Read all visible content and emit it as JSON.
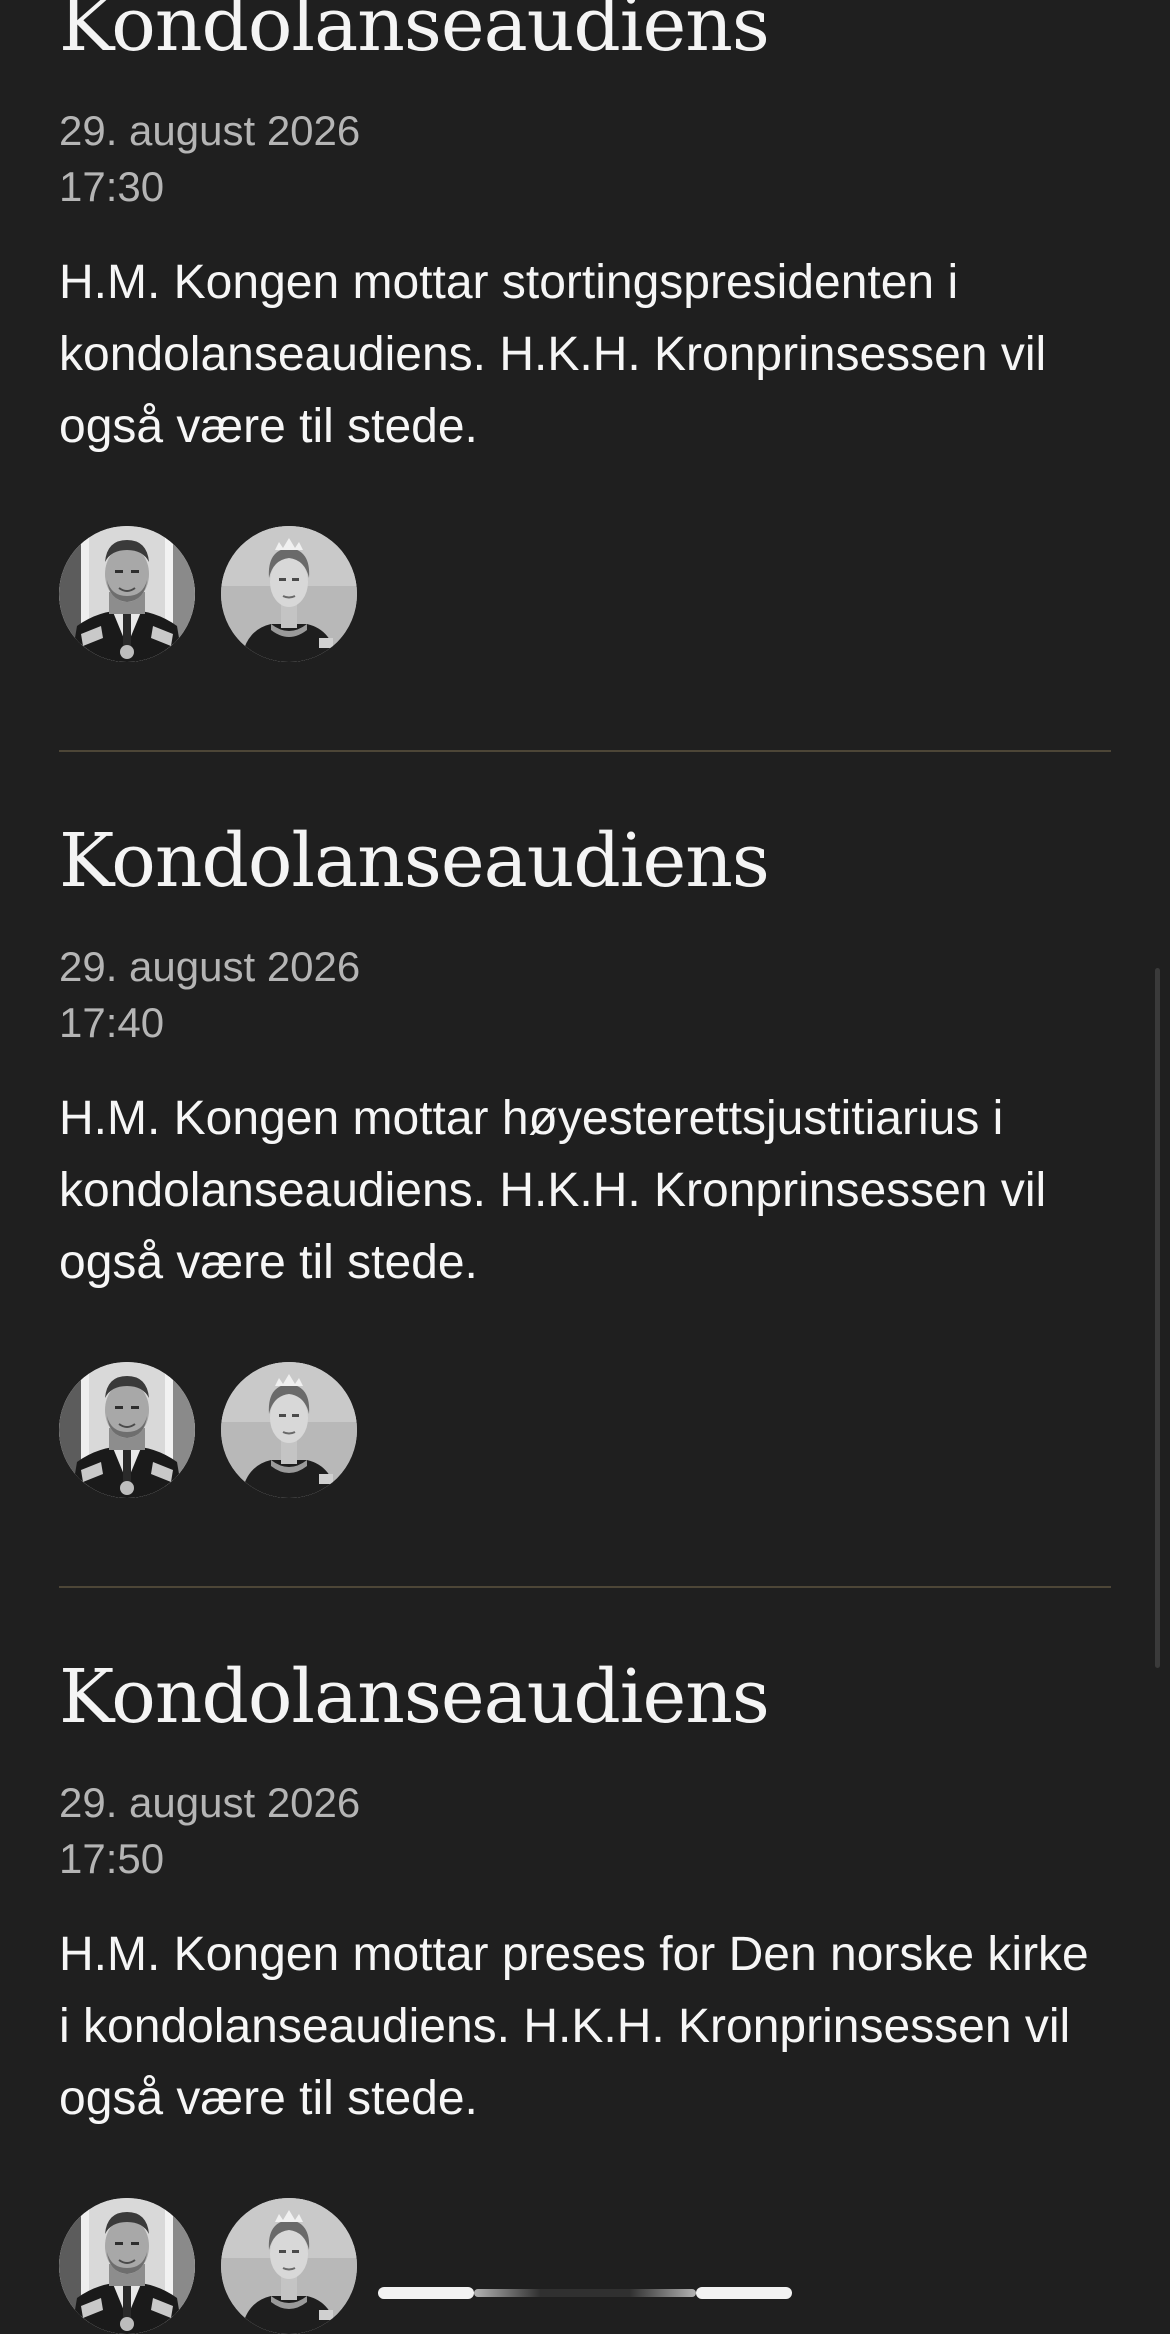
{
  "events": [
    {
      "title": "Kondolanseaudiens",
      "date": "29. august 2026",
      "time": "17:30",
      "description": "H.M. Kongen mottar stortingspresidenten i kondolanseaudiens. H.K.H. Kronprinsessen vil også være til stede.",
      "participants": [
        "avatar-king-icon",
        "avatar-crown-princess-icon"
      ]
    },
    {
      "title": "Kondolanseaudiens",
      "date": "29. august 2026",
      "time": "17:40",
      "description": "H.M. Kongen mottar høyesterettsjustitiarius i kondolanseaudiens. H.K.H. Kronprinsessen vil også være til stede.",
      "participants": [
        "avatar-king-icon",
        "avatar-crown-princess-icon"
      ]
    },
    {
      "title": "Kondolanseaudiens",
      "date": "29. august 2026",
      "time": "17:50",
      "description": "H.M. Kongen mottar preses for Den norske kirke i kondolanseaudiens. H.K.H. Kronprinsessen vil også være til stede.",
      "participants": [
        "avatar-king-icon",
        "avatar-crown-princess-icon"
      ]
    }
  ],
  "colors": {
    "background": "#1f1f1f",
    "divider": "#4d4637",
    "title_text": "#f4f4f4",
    "meta_text": "#b5b5b5",
    "body_text": "#f6f6f6"
  }
}
